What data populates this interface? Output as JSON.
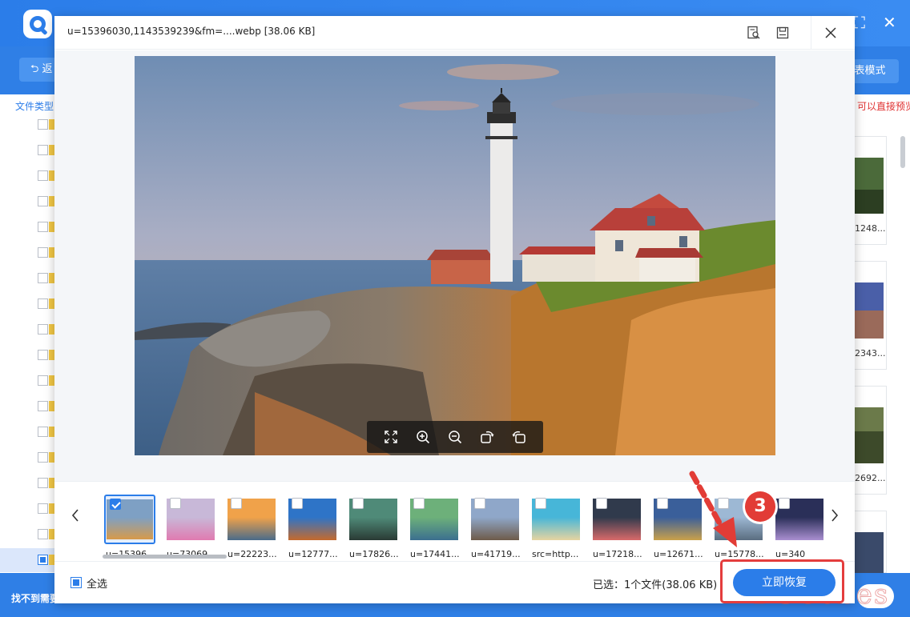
{
  "app": {
    "back_label": "返",
    "list_mode_label": "表模式",
    "file_type_label": "文件类型",
    "preview_hint": "可以直接预览",
    "footer_text": "找不到需要",
    "watermark": "DSCobes"
  },
  "background_cards": [
    {
      "caption": "1248..."
    },
    {
      "caption": "2343..."
    },
    {
      "caption": "2692..."
    }
  ],
  "dialog": {
    "title": "u=15396030,1143539239&fm=....webp [38.06 KB]",
    "icons": [
      "search-file-icon",
      "save-icon",
      "close-icon"
    ],
    "toolbar_icons": [
      "fullscreen-icon",
      "zoom-in-icon",
      "zoom-out-icon",
      "rotate-right-icon",
      "rotate-left-icon"
    ],
    "thumbnails": [
      {
        "caption": "u=15396...",
        "checked": true,
        "active": true,
        "colors": [
          "#7ea0c4",
          "#d79a4a"
        ]
      },
      {
        "caption": "u=73069...",
        "checked": false,
        "colors": [
          "#c8b8d8",
          "#e07ab0"
        ]
      },
      {
        "caption": "u=22223...",
        "checked": false,
        "colors": [
          "#f0a24a",
          "#4a6b8a"
        ]
      },
      {
        "caption": "u=12777...",
        "checked": false,
        "colors": [
          "#2e74c7",
          "#c46a2e"
        ]
      },
      {
        "caption": "u=17826...",
        "checked": false,
        "colors": [
          "#4f8a78",
          "#2a3a34"
        ]
      },
      {
        "caption": "u=17441...",
        "checked": false,
        "colors": [
          "#6db07a",
          "#3b6f8f"
        ]
      },
      {
        "caption": "u=41719...",
        "checked": false,
        "colors": [
          "#8fa7c9",
          "#6e5b4a"
        ]
      },
      {
        "caption": "src=http...",
        "checked": false,
        "colors": [
          "#47b6d8",
          "#e6d4a0"
        ]
      },
      {
        "caption": "u=17218...",
        "checked": false,
        "colors": [
          "#303a4c",
          "#d86a6a"
        ]
      },
      {
        "caption": "u=12671...",
        "checked": false,
        "colors": [
          "#3a5f9a",
          "#c9a14a"
        ]
      },
      {
        "caption": "u=15778...",
        "checked": false,
        "colors": [
          "#9db8d4",
          "#5a6d80"
        ]
      },
      {
        "caption": "u=340",
        "checked": false,
        "colors": [
          "#2a2f58",
          "#a98fd0"
        ]
      }
    ],
    "select_all_label": "全选",
    "selected_info": "已选：1个文件(38.06 KB)",
    "recover_label": "立即恢复"
  },
  "annotation": {
    "step_number": "3"
  },
  "colors": {
    "accent": "#2b7de9",
    "highlight": "#e43d3d"
  }
}
